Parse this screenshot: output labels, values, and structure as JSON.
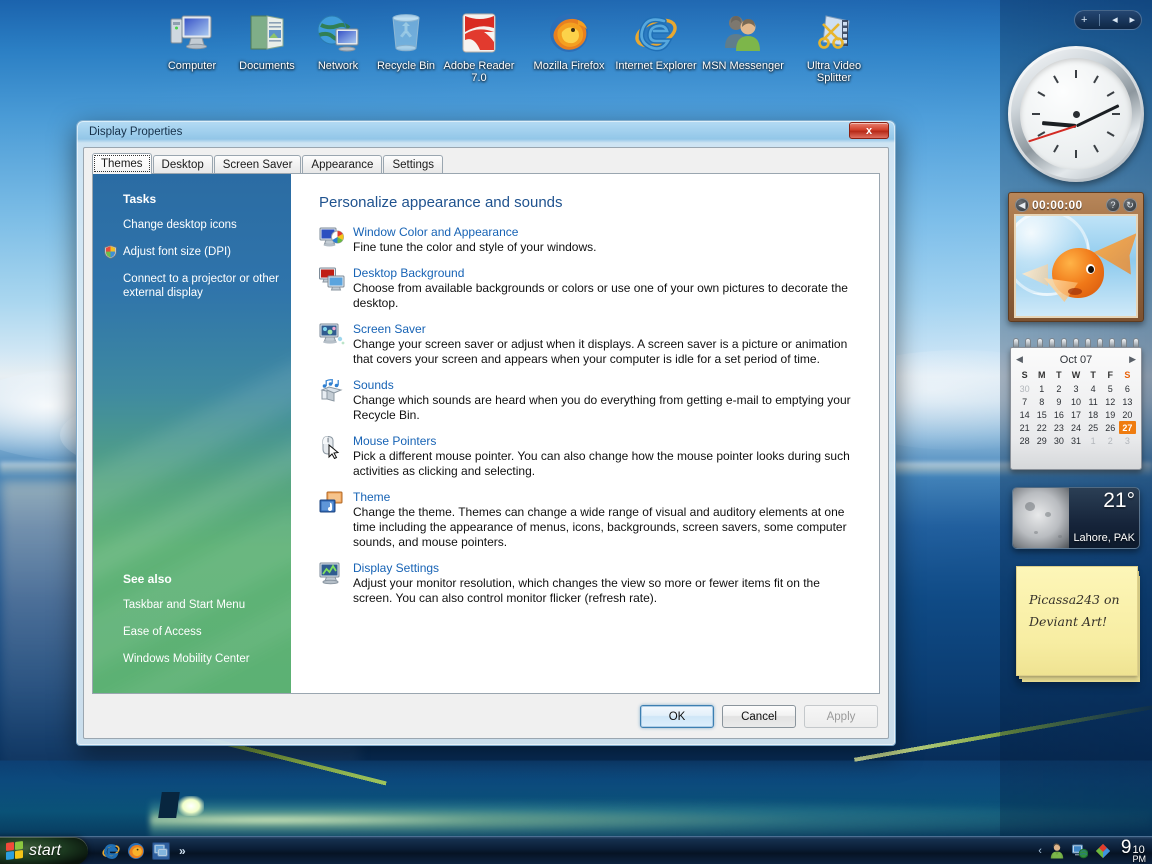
{
  "desktop": {
    "icons": [
      {
        "name": "computer-icon",
        "label": "Computer"
      },
      {
        "name": "documents-icon",
        "label": "Documents"
      },
      {
        "name": "network-icon",
        "label": "Network"
      },
      {
        "name": "recycle-bin-icon",
        "label": "Recycle Bin"
      },
      {
        "name": "adobe-reader-icon",
        "label": "Adobe Reader 7.0"
      },
      {
        "name": "mozilla-firefox-icon",
        "label": "Mozilla Firefox"
      },
      {
        "name": "internet-explorer-icon",
        "label": "Internet Explorer"
      },
      {
        "name": "msn-messenger-icon",
        "label": "MSN Messenger"
      },
      {
        "name": "ultra-video-splitter-icon",
        "label": "Ultra Video Splitter"
      }
    ]
  },
  "sidebar": {
    "toolbar": {
      "add": "+",
      "prev": "◂",
      "next": "▸"
    },
    "clock": {
      "hour": 9,
      "minute": 10,
      "second": 42
    },
    "slideshow": {
      "time": "00:00:00",
      "help_label": "?",
      "refresh_label": "↻"
    },
    "calendar": {
      "month_label": "Oct 07",
      "prev_label": "◀",
      "next_label": "▶",
      "day_headers": [
        "S",
        "M",
        "T",
        "W",
        "T",
        "F",
        "S"
      ],
      "weeks": [
        [
          {
            "d": "30",
            "muted": true
          },
          {
            "d": "1"
          },
          {
            "d": "2"
          },
          {
            "d": "3"
          },
          {
            "d": "4"
          },
          {
            "d": "5"
          },
          {
            "d": "6"
          }
        ],
        [
          {
            "d": "7"
          },
          {
            "d": "8"
          },
          {
            "d": "9"
          },
          {
            "d": "10"
          },
          {
            "d": "11"
          },
          {
            "d": "12"
          },
          {
            "d": "13"
          }
        ],
        [
          {
            "d": "14"
          },
          {
            "d": "15"
          },
          {
            "d": "16"
          },
          {
            "d": "17"
          },
          {
            "d": "18"
          },
          {
            "d": "19"
          },
          {
            "d": "20"
          }
        ],
        [
          {
            "d": "21"
          },
          {
            "d": "22"
          },
          {
            "d": "23"
          },
          {
            "d": "24"
          },
          {
            "d": "25"
          },
          {
            "d": "26"
          },
          {
            "d": "27",
            "today": true
          }
        ],
        [
          {
            "d": "28"
          },
          {
            "d": "29"
          },
          {
            "d": "30"
          },
          {
            "d": "31"
          },
          {
            "d": "1",
            "muted": true
          },
          {
            "d": "2",
            "muted": true
          },
          {
            "d": "3",
            "muted": true
          }
        ]
      ],
      "today_accent": "#ef7c10"
    },
    "weather": {
      "temperature": "21°",
      "location": "Lahore, PAK"
    },
    "notes": {
      "line1": "Picassa243 on",
      "line2": "Deviant Art!"
    }
  },
  "dialog": {
    "title": "Display Properties",
    "close_label": "x",
    "tabs": [
      {
        "label": "Themes",
        "active": true
      },
      {
        "label": "Desktop",
        "active": false
      },
      {
        "label": "Screen Saver",
        "active": false
      },
      {
        "label": "Appearance",
        "active": false
      },
      {
        "label": "Settings",
        "active": false
      }
    ],
    "sidebar": {
      "tasks_heading": "Tasks",
      "tasks": [
        {
          "label": "Change desktop icons",
          "shield": false
        },
        {
          "label": "Adjust font size (DPI)",
          "shield": true
        },
        {
          "label": "Connect to a projector or other external display",
          "shield": false
        }
      ],
      "seealso_heading": "See also",
      "seealso": [
        {
          "label": "Taskbar and Start Menu"
        },
        {
          "label": "Ease of Access"
        },
        {
          "label": "Windows Mobility Center"
        }
      ]
    },
    "content": {
      "title": "Personalize appearance and sounds",
      "items": [
        {
          "icon": "window-color-icon",
          "link": "Window Color and Appearance",
          "desc": "Fine tune the color and style of your windows."
        },
        {
          "icon": "desktop-background-icon",
          "link": "Desktop Background",
          "desc": "Choose from available backgrounds or colors or use one of your own pictures to decorate the desktop."
        },
        {
          "icon": "screen-saver-icon",
          "link": "Screen Saver",
          "desc": "Change your screen saver or adjust when it displays. A screen saver is a picture or animation that covers your screen and appears when your computer is idle for a set period of time."
        },
        {
          "icon": "sounds-icon",
          "link": "Sounds",
          "desc": "Change which sounds are heard when you do everything from getting e-mail to emptying your Recycle Bin."
        },
        {
          "icon": "mouse-pointers-icon",
          "link": "Mouse Pointers",
          "desc": "Pick a different mouse pointer. You can also change how the mouse pointer looks during such activities as clicking and selecting."
        },
        {
          "icon": "theme-icon",
          "link": "Theme",
          "desc": "Change the theme. Themes can change a wide range of visual and auditory elements at one time including the appearance of menus, icons, backgrounds, screen savers, some computer sounds, and mouse pointers."
        },
        {
          "icon": "display-settings-icon",
          "link": "Display Settings",
          "desc": "Adjust your monitor resolution, which changes the view so more or fewer items fit on the screen. You can also control monitor flicker (refresh rate)."
        }
      ]
    },
    "buttons": {
      "ok": "OK",
      "cancel": "Cancel",
      "apply": "Apply"
    }
  },
  "taskbar": {
    "start_label": "start",
    "quicklaunch": [
      {
        "name": "internet-explorer-icon"
      },
      {
        "name": "mozilla-firefox-icon"
      },
      {
        "name": "show-desktop-icon"
      }
    ],
    "overflow_label": "»",
    "tray": {
      "chevron_label": "‹",
      "icons": [
        {
          "name": "user-account-icon"
        },
        {
          "name": "network-icon"
        },
        {
          "name": "security-icon"
        }
      ],
      "clock": {
        "hour": "9",
        "minute": "10",
        "ampm": "PM"
      }
    }
  },
  "colors": {
    "link": "#1763b5",
    "heading": "#20538f",
    "sidebar_top": "#2b6ca3",
    "sidebar_bottom": "#5cb173",
    "today_highlight": "#ef7c10",
    "close_button": "#d2412c"
  }
}
